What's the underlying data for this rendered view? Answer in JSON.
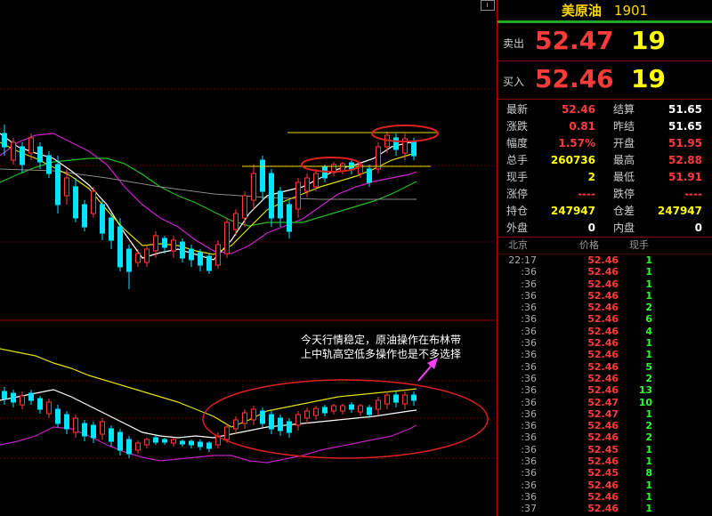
{
  "chart_annotation": {
    "line1": "今天行情稳定，原油操作在布林带",
    "line2": "上中轨高空低多操作也是不多选择"
  },
  "instrument": {
    "name": "美原油",
    "code": "1901"
  },
  "ask": {
    "label": "卖出",
    "price": "52.47",
    "volume": "19"
  },
  "bid": {
    "label": "买入",
    "price": "52.46",
    "volume": "19"
  },
  "stats": [
    {
      "k1": "最新",
      "v1": "52.46",
      "c1": "red",
      "k2": "结算",
      "v2": "51.65",
      "c2": "white"
    },
    {
      "k1": "涨跌",
      "v1": "0.81",
      "c1": "red",
      "k2": "昨结",
      "v2": "51.65",
      "c2": "white"
    },
    {
      "k1": "幅度",
      "v1": "1.57%",
      "c1": "red",
      "k2": "开盘",
      "v2": "51.95",
      "c2": "red"
    },
    {
      "k1": "总手",
      "v1": "260736",
      "c1": "yellow",
      "k2": "最高",
      "v2": "52.88",
      "c2": "red"
    },
    {
      "k1": "现手",
      "v1": "2",
      "c1": "yellow",
      "k2": "最低",
      "v2": "51.91",
      "c2": "red"
    },
    {
      "k1": "涨停",
      "v1": "----",
      "c1": "red",
      "k2": "跌停",
      "v2": "----",
      "c2": "red"
    },
    {
      "k1": "持仓",
      "v1": "247947",
      "c1": "yellow",
      "k2": "仓差",
      "v2": "247947",
      "c2": "yellow"
    },
    {
      "k1": "外盘",
      "v1": "0",
      "c1": "white",
      "k2": "内盘",
      "v2": "0",
      "c2": "white"
    }
  ],
  "ticks_header": {
    "time": "北京",
    "price": "价格",
    "volume": "现手"
  },
  "ticks": [
    {
      "time": "22:17",
      "price": "52.46",
      "volume": "1"
    },
    {
      "time": ":36",
      "price": "52.46",
      "volume": "1"
    },
    {
      "time": ":36",
      "price": "52.46",
      "volume": "1"
    },
    {
      "time": ":36",
      "price": "52.46",
      "volume": "1"
    },
    {
      "time": ":36",
      "price": "52.46",
      "volume": "2"
    },
    {
      "time": ":36",
      "price": "52.46",
      "volume": "6"
    },
    {
      "time": ":36",
      "price": "52.46",
      "volume": "4"
    },
    {
      "time": ":36",
      "price": "52.46",
      "volume": "1"
    },
    {
      "time": ":36",
      "price": "52.46",
      "volume": "1"
    },
    {
      "time": ":36",
      "price": "52.46",
      "volume": "5"
    },
    {
      "time": ":36",
      "price": "52.46",
      "volume": "2"
    },
    {
      "time": ":36",
      "price": "52.46",
      "volume": "13"
    },
    {
      "time": ":36",
      "price": "52.47",
      "volume": "10"
    },
    {
      "time": ":36",
      "price": "52.47",
      "volume": "1"
    },
    {
      "time": ":36",
      "price": "52.46",
      "volume": "2"
    },
    {
      "time": ":36",
      "price": "52.46",
      "volume": "2"
    },
    {
      "time": ":36",
      "price": "52.45",
      "volume": "1"
    },
    {
      "time": ":36",
      "price": "52.46",
      "volume": "1"
    },
    {
      "time": ":36",
      "price": "52.45",
      "volume": "8"
    },
    {
      "time": ":36",
      "price": "52.46",
      "volume": "1"
    },
    {
      "time": ":36",
      "price": "52.46",
      "volume": "1"
    },
    {
      "time": ":37",
      "price": "52.46",
      "volume": "1"
    }
  ],
  "colors": {
    "up": "#ff3b3b",
    "down": "#00e5ff",
    "ma_white": "#ffffff",
    "ma_yellow": "#e0e000",
    "ma_magenta": "#d020d0",
    "ma_green": "#22c022",
    "highlight": "#e02020"
  }
}
